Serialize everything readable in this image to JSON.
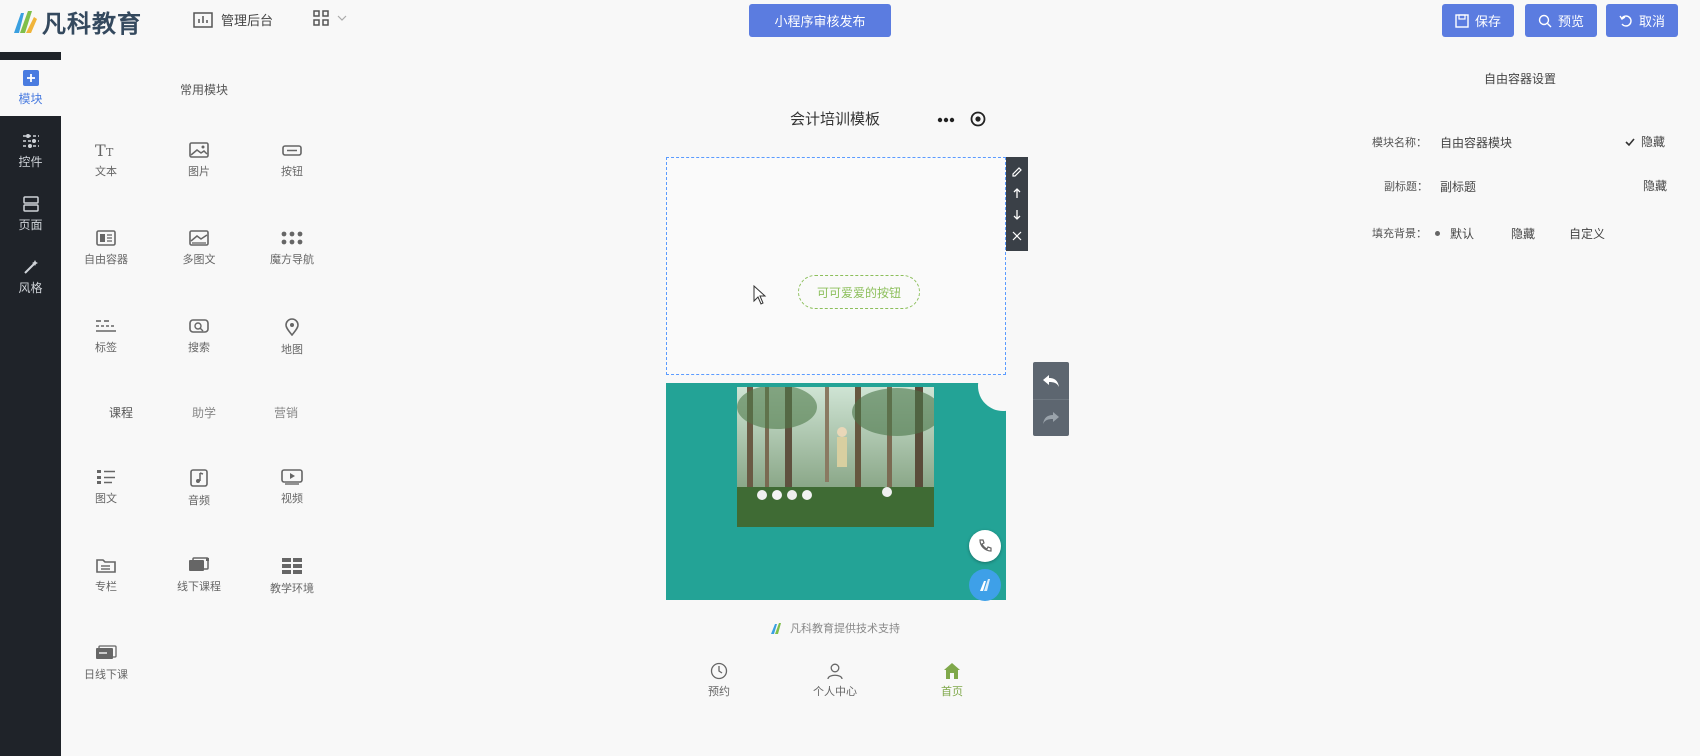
{
  "header": {
    "logo_text": "凡科教育",
    "admin_label": "管理后台",
    "publish_label": "小程序审核发布",
    "save_label": "保存",
    "preview_label": "预览",
    "cancel_label": "取消"
  },
  "leftnav": {
    "items": [
      {
        "label": "模块",
        "icon": "plus-square-icon"
      },
      {
        "label": "控件",
        "icon": "sliders-icon"
      },
      {
        "label": "页面",
        "icon": "layout-icon"
      },
      {
        "label": "风格",
        "icon": "magic-wand-icon"
      }
    ]
  },
  "modules": {
    "common_title": "常用模块",
    "common": [
      {
        "label": "文本",
        "icon": "text-icon"
      },
      {
        "label": "图片",
        "icon": "image-icon"
      },
      {
        "label": "按钮",
        "icon": "button-icon"
      },
      {
        "label": "自由容器",
        "icon": "container-icon"
      },
      {
        "label": "多图文",
        "icon": "multi-image-icon"
      },
      {
        "label": "魔方导航",
        "icon": "dots-grid-icon"
      },
      {
        "label": "标签",
        "icon": "tabs-icon"
      },
      {
        "label": "搜索",
        "icon": "search-icon"
      },
      {
        "label": "地图",
        "icon": "map-pin-icon"
      }
    ],
    "category_tabs": [
      "课程",
      "助学",
      "营销"
    ],
    "course": [
      {
        "label": "图文",
        "icon": "list-icon"
      },
      {
        "label": "音频",
        "icon": "music-icon"
      },
      {
        "label": "视频",
        "icon": "video-icon"
      },
      {
        "label": "专栏",
        "icon": "folder-icon"
      },
      {
        "label": "线下课程",
        "icon": "offline-course-icon"
      },
      {
        "label": "教学环境",
        "icon": "grid-icon"
      },
      {
        "label": "日线下课",
        "icon": "calendar-class-icon"
      }
    ]
  },
  "canvas": {
    "page_title": "会计培训模板",
    "button_text": "可可爱爱的按钮",
    "support_text": "凡科教育提供技术支持",
    "tabs": [
      {
        "label": "预约",
        "icon": "clock-icon"
      },
      {
        "label": "个人中心",
        "icon": "user-icon"
      },
      {
        "label": "首页",
        "icon": "home-icon"
      }
    ]
  },
  "settings": {
    "title": "自由容器设置",
    "module_name_label": "模块名称：",
    "module_name_value": "自由容器模块",
    "hide_label_1": "隐藏",
    "subtitle_label": "副标题：",
    "subtitle_value": "副标题",
    "hide_label_2": "隐藏",
    "bg_label": "填充背景：",
    "bg_options": [
      "默认",
      "隐藏",
      "自定义"
    ]
  },
  "colors": {
    "accent": "#5b7ce0",
    "nav_bg": "#1f2329",
    "teal": "#23a396",
    "active_tab": "#7fa84a"
  }
}
